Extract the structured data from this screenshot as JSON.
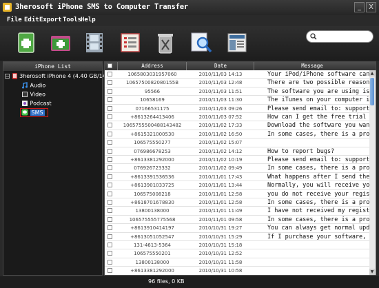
{
  "app": {
    "title": "3herosoft iPhone SMS to Computer Transfer",
    "window_buttons": {
      "minimize": "_",
      "close": "X"
    }
  },
  "menu": [
    "File",
    "Edit",
    "Export",
    "Tools",
    "Help"
  ],
  "toolbar": {
    "buttons": [
      {
        "name": "export-file-button",
        "icon": "file-export-icon"
      },
      {
        "name": "export-folder-button",
        "icon": "folder-export-icon"
      },
      {
        "name": "video-button",
        "icon": "film-icon"
      },
      {
        "name": "list-button",
        "icon": "list-icon"
      },
      {
        "name": "delete-button",
        "icon": "trash-icon"
      },
      {
        "name": "search-tool-button",
        "icon": "magnifier-icon"
      },
      {
        "name": "view-button",
        "icon": "panel-icon"
      }
    ],
    "search": {
      "placeholder": ""
    }
  },
  "sidebar": {
    "header": "iPhone List",
    "device": "3herosoft iPhone 4 (4.40 GB/14.00 C",
    "items": [
      {
        "label": "Audio",
        "icon": "audio-icon"
      },
      {
        "label": "Video",
        "icon": "video-icon"
      },
      {
        "label": "Podcast",
        "icon": "podcast-icon"
      },
      {
        "label": "SMS",
        "icon": "sms-icon",
        "selected": true
      }
    ]
  },
  "table": {
    "columns": [
      "Address",
      "Date",
      "Message"
    ],
    "rows": [
      {
        "address": "1065803031957060",
        "date": "2010/11/03 14:13",
        "message": "Your iPod/iPhone software can"
      },
      {
        "address": "1065750082080155B",
        "date": "2010/11/03 12:48",
        "message": "There are two possible reason"
      },
      {
        "address": "95566",
        "date": "2010/11/03 11:51",
        "message": "The software you are using is"
      },
      {
        "address": "10658169",
        "date": "2010/11/03 11:30",
        "message": "The iTunes on your computer i"
      },
      {
        "address": "07166531175",
        "date": "2010/11/03 09:26",
        "message": "Please send email to: support"
      },
      {
        "address": "+8613264413406",
        "date": "2010/11/03 07:52",
        "message": "How can I get the free trial"
      },
      {
        "address": "1065755500488143482",
        "date": "2010/11/02 17:33",
        "message": "Download the software you wan"
      },
      {
        "address": "+8615321000530",
        "date": "2010/11/02 16:50",
        "message": "In some cases, there is a pro"
      },
      {
        "address": "106575550277",
        "date": "2010/11/02 15:07",
        "message": ""
      },
      {
        "address": "07698667825З",
        "date": "2010/11/02 14:12",
        "message": "How to report bugs?"
      },
      {
        "address": "+8613381292000",
        "date": "2010/11/02 10:19",
        "message": "Please send email to: support"
      },
      {
        "address": "076926723332",
        "date": "2010/11/02 09:49",
        "message": "In some cases, there is a pro"
      },
      {
        "address": "+8613391536536",
        "date": "2010/11/01 17:43",
        "message": "What happens after I send the"
      },
      {
        "address": "+8613901033725",
        "date": "2010/11/01 13:44",
        "message": "Normally, you will receive yo"
      },
      {
        "address": "106575008218",
        "date": "2010/11/01 12:58",
        "message": "you do not receive your regis"
      },
      {
        "address": "+8618701678830",
        "date": "2010/11/01 12:58",
        "message": "In some cases, there is a pro"
      },
      {
        "address": "13800138000",
        "date": "2010/11/01 11:49",
        "message": "I have not received my regist"
      },
      {
        "address": "106575555775568",
        "date": "2010/11/01 09:58",
        "message": "In some cases, there is a pro"
      },
      {
        "address": "+8613910414197",
        "date": "2010/10/31 19:27",
        "message": "You can always get normal upd"
      },
      {
        "address": "+8613051052547",
        "date": "2010/10/31 15:29",
        "message": "If I purchase your software,"
      },
      {
        "address": "131-4613-5364",
        "date": "2010/10/31 15:18",
        "message": ""
      },
      {
        "address": "106575550201",
        "date": "2010/10/31 12:52",
        "message": ""
      },
      {
        "address": "13800138000",
        "date": "2010/10/31 11:58",
        "message": ""
      },
      {
        "address": "+8613381292000",
        "date": "2010/10/31 10:58",
        "message": ""
      }
    ]
  },
  "status": {
    "text": "96 files, 0 KB"
  },
  "colors": {
    "accent_blue": "#5a8ed0",
    "selection_outline": "#d01818",
    "bg_dark": "#2a2a2a"
  }
}
